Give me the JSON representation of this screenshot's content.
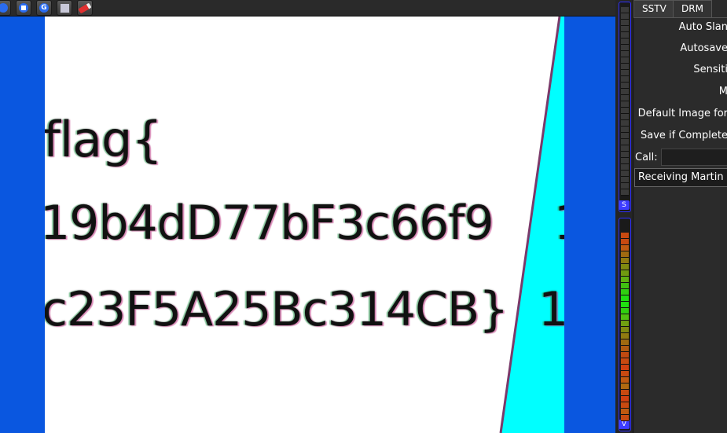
{
  "toolbar": {
    "buttons": [
      {
        "name": "receive-play-icon",
        "glyph": "▶"
      },
      {
        "name": "stop-icon",
        "glyph": "■"
      },
      {
        "name": "refresh-icon",
        "glyph": "G"
      },
      {
        "name": "save-icon",
        "glyph": "▤"
      },
      {
        "name": "eraser-icon",
        "glyph": "◢"
      }
    ]
  },
  "image": {
    "lines": [
      "flag{",
      "19b4dD77bF3c66f9",
      "c23F5A25Bc314CB}"
    ],
    "right_fragments": [
      "1",
      "1("
    ]
  },
  "meters": {
    "top_thumb": "S",
    "bottom_thumb": "V"
  },
  "panel": {
    "tabs": [
      "SSTV",
      "DRM"
    ],
    "auto_slant": "Auto Slan",
    "autosave": "Autosave",
    "sensitivity": "Sensiti",
    "mode": "M",
    "default_image_format": "Default Image for",
    "save_if_complete": "Save if Complete",
    "call_label": "Call:",
    "call_value": "",
    "status": "Receiving Martin"
  },
  "colors": {
    "background_blue": "#0a57e0",
    "cyan_bar": "#00ffff"
  }
}
